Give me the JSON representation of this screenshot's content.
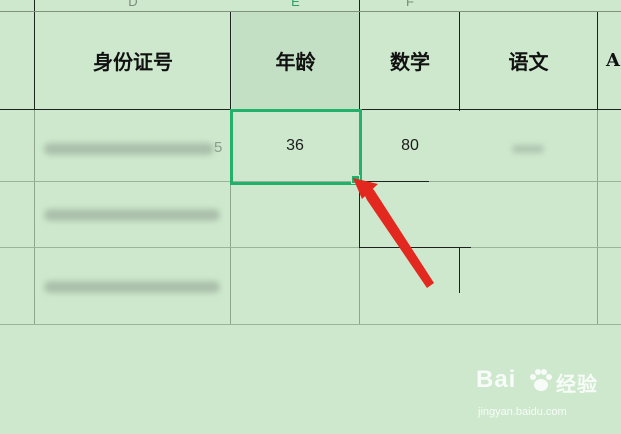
{
  "spreadsheet": {
    "column_letters": {
      "D": "D",
      "E": "E",
      "F": "F"
    },
    "headers": {
      "id_number": "身份证号",
      "age": "年龄",
      "math": "数学",
      "chinese": "语文",
      "cut_off": "A"
    },
    "rows": [
      {
        "id_number_tail": "5",
        "age": "36",
        "math": "80",
        "chinese": ""
      }
    ],
    "selected_cell": "E",
    "accent_color": "#23b06b",
    "arrow_color": "#e3281f"
  },
  "watermark": {
    "logo": "Bai",
    "logo_suffix": "经验",
    "url": "jingyan.baidu.com"
  }
}
